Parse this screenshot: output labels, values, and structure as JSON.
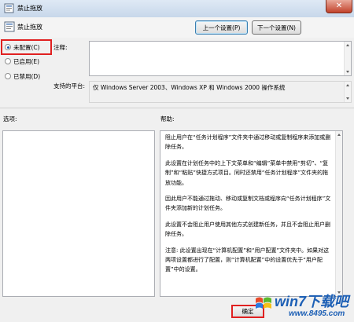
{
  "window": {
    "title": "禁止拖放",
    "close_symbol": "✕"
  },
  "header": {
    "policy_name": "禁止拖放"
  },
  "nav": {
    "prev_label": "上一个设置(P)",
    "next_label": "下一个设置(N)"
  },
  "state": {
    "options": [
      {
        "label": "未配置(C)",
        "checked": true
      },
      {
        "label": "已启用(E)",
        "checked": false
      },
      {
        "label": "已禁用(D)",
        "checked": false
      }
    ]
  },
  "comment": {
    "label": "注释:",
    "value": ""
  },
  "platform": {
    "label": "支持的平台:",
    "value": "仅 Windows Server 2003、Windows XP 和 Windows 2000 操作系统"
  },
  "options_section": {
    "label": "选项:"
  },
  "help": {
    "label": "帮助:",
    "paragraphs": [
      "阻止用户在“任务计划程序”文件夹中通过移动或复制程序来添加或删除任务。",
      "此设置在计划任务中的上下文菜单和“编辑”菜单中禁用“剪切”、“复制”和“粘贴”快捷方式项目。同时还禁用“任务计划程序”文件夹的拖放功能。",
      "因此用户不能通过拖动、移动或复制文档或程序向“任务计划程序”文件夹添加新的计划任务。",
      "此设置不会阻止用户使用其他方式创建新任务，并且不会阻止用户删除任务。",
      "注意: 此设置出现在“计算机配置”和“用户配置”文件夹中。如果对这两项设置都进行了配置，则“计算机配置”中的设置优先于“用户配置”中的设置。"
    ]
  },
  "footer": {
    "ok_label": "确定"
  },
  "watermark": {
    "main": "win7下载吧",
    "url": "www.8495.com"
  }
}
